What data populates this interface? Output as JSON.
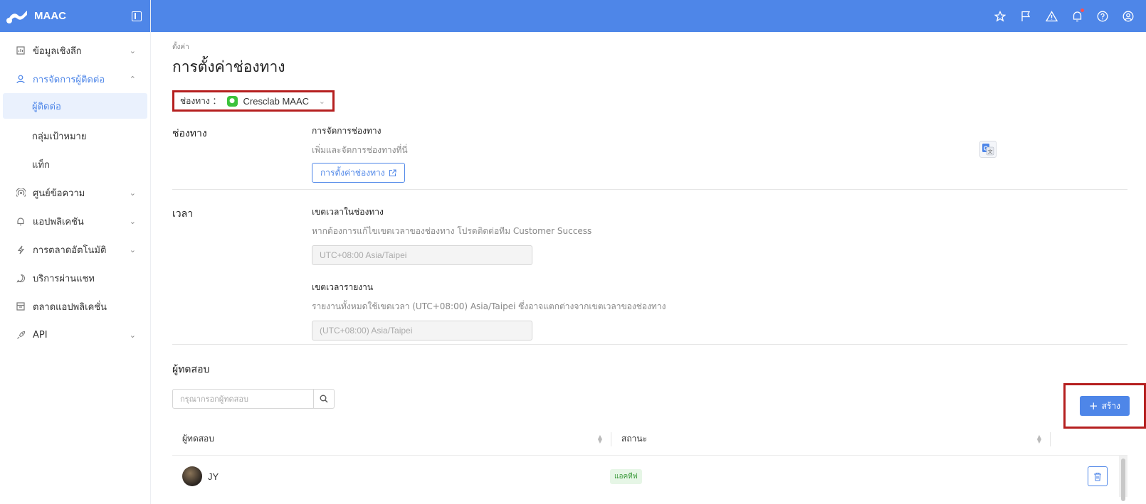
{
  "brand": {
    "name": "MAAC"
  },
  "sidebar": {
    "items": [
      {
        "label": "ข้อมูลเชิงลึก",
        "icon": "chart-icon"
      },
      {
        "label": "การจัดการผู้ติดต่อ",
        "icon": "user-icon"
      },
      {
        "label": "ศูนย์ข้อความ",
        "icon": "broadcast-icon"
      },
      {
        "label": "แอปพลิเคชัน",
        "icon": "bell-icon"
      },
      {
        "label": "การตลาดอัตโนมัติ",
        "icon": "bolt-icon"
      },
      {
        "label": "บริการผ่านแชท",
        "icon": "chat-icon"
      },
      {
        "label": "ตลาดแอปพลิเคชั่น",
        "icon": "store-icon"
      },
      {
        "label": "API",
        "icon": "rocket-icon"
      }
    ],
    "sub_items": [
      "ผู้ติดต่อ",
      "กลุ่มเป้าหมาย",
      "แท็ก"
    ]
  },
  "breadcrumb": "ตั้งค่า",
  "page_title": "การตั้งค่าช่องทาง",
  "channel_select": {
    "label": "ช่องทาง ：",
    "value": "Cresclab MAAC"
  },
  "channel_section": {
    "label": "ช่องทาง",
    "title": "การจัดการช่องทาง",
    "desc": "เพิ่มและจัดการช่องทางที่นี่",
    "button": "การตั้งค่าช่องทาง"
  },
  "time_section": {
    "label": "เวลา",
    "tz_title": "เขตเวลาในช่องทาง",
    "tz_desc": "หากต้องการแก้ไขเขตเวลาของช่องทาง โปรดติดต่อทีม Customer Success",
    "tz_value": "UTC+08:00 Asia/Taipei",
    "report_title": "เขตเวลารายงาน",
    "report_desc": "รายงานทั้งหมดใช้เขตเวลา (UTC+08:00) Asia/Taipei ซึ่งอาจแตกต่างจากเขตเวลาของช่องทาง",
    "report_value": "(UTC+08:00) Asia/Taipei"
  },
  "testers": {
    "title": "ผู้ทดสอบ",
    "search_placeholder": "กรุณากรอกผู้ทดสอบ",
    "create_label": "สร้าง",
    "columns": [
      "ผู้ทดสอบ",
      "สถานะ"
    ],
    "rows": [
      {
        "name": "JY",
        "status": "แอคทีฟ"
      }
    ]
  },
  "colors": {
    "primary": "#4e86e8",
    "highlight": "#b51f1f",
    "line_green": "#3cc23c"
  }
}
